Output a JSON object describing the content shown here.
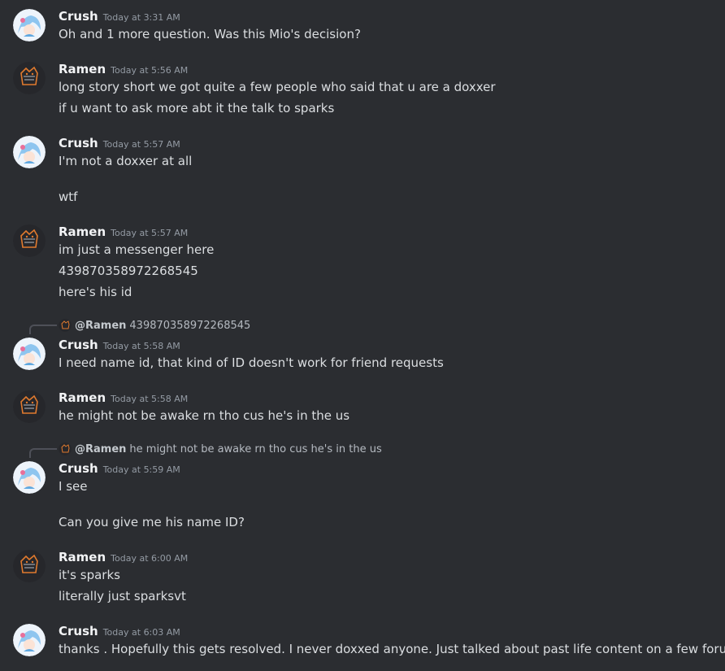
{
  "messages": [
    {
      "author": "Crush",
      "time": "Today at 3:31 AM",
      "lines": [
        "Oh and 1 more question. Was this Mio's decision?"
      ]
    },
    {
      "author": "Ramen",
      "time": "Today at 5:56 AM",
      "lines": [
        "long story short we got quite a few people who said that u are a doxxer",
        "if u want to ask more abt it the talk to sparks"
      ]
    },
    {
      "author": "Crush",
      "time": "Today at 5:57 AM",
      "lines": [
        "I'm not a doxxer at all",
        "wtf"
      ]
    },
    {
      "author": "Ramen",
      "time": "Today at 5:57 AM",
      "lines": [
        "im just a messenger here",
        "439870358972268545",
        "here's his id"
      ]
    },
    {
      "author": "Crush",
      "time": "Today at 5:58 AM",
      "reply": {
        "name": "@Ramen",
        "text": "439870358972268545"
      },
      "lines": [
        "I need name id, that kind of ID doesn't work for friend requests"
      ]
    },
    {
      "author": "Ramen",
      "time": "Today at 5:58 AM",
      "lines": [
        "he might not be awake rn tho cus he's in the us"
      ]
    },
    {
      "author": "Crush",
      "time": "Today at 5:59 AM",
      "reply": {
        "name": "@Ramen",
        "text": "he might not be awake rn tho cus he's in the us"
      },
      "lines": [
        "I see",
        "Can you give me his name ID?"
      ]
    },
    {
      "author": "Ramen",
      "time": "Today at 6:00 AM",
      "lines": [
        "it's sparks",
        "literally just sparksvt"
      ]
    },
    {
      "author": "Crush",
      "time": "Today at 6:03 AM",
      "lines": [
        "thanks . Hopefully this gets resolved. I never doxxed anyone. Just talked about past life content on a few forums"
      ]
    }
  ]
}
